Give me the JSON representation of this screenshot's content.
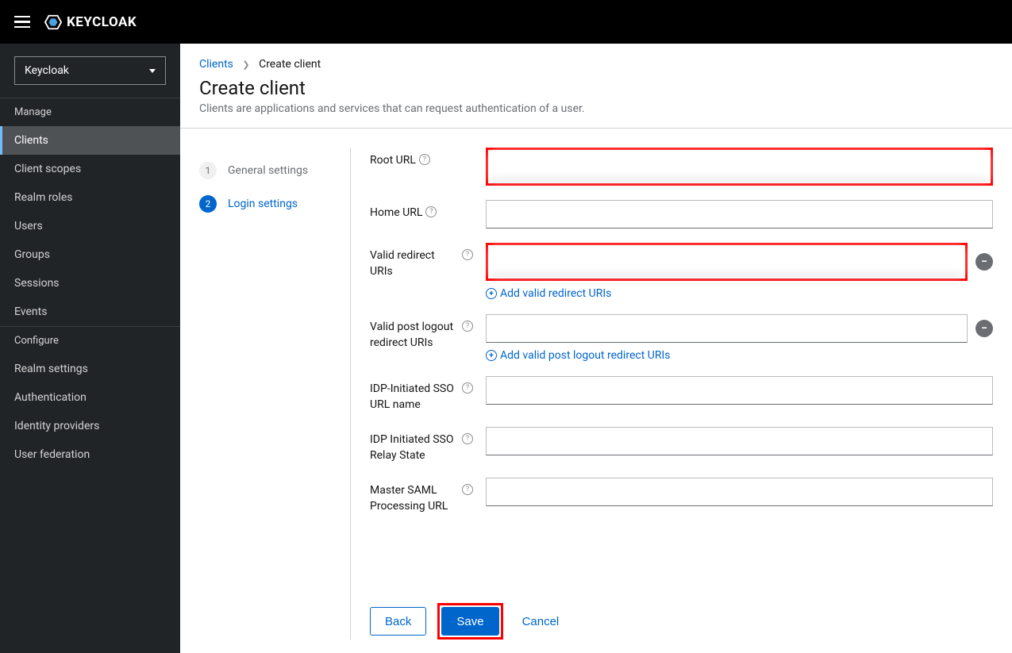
{
  "brand": "KEYCLOAK",
  "realmSelector": {
    "value": "Keycloak"
  },
  "sidebar": {
    "manageTitle": "Manage",
    "configureTitle": "Configure",
    "manage": [
      {
        "label": "Clients",
        "active": true
      },
      {
        "label": "Client scopes"
      },
      {
        "label": "Realm roles"
      },
      {
        "label": "Users"
      },
      {
        "label": "Groups"
      },
      {
        "label": "Sessions"
      },
      {
        "label": "Events"
      }
    ],
    "configure": [
      {
        "label": "Realm settings"
      },
      {
        "label": "Authentication"
      },
      {
        "label": "Identity providers"
      },
      {
        "label": "User federation"
      }
    ]
  },
  "breadcrumb": {
    "parent": "Clients",
    "current": "Create client"
  },
  "page": {
    "title": "Create client",
    "desc": "Clients are applications and services that can request authentication of a user."
  },
  "wizard": {
    "steps": [
      {
        "num": "1",
        "label": "General settings"
      },
      {
        "num": "2",
        "label": "Login settings",
        "active": true
      }
    ]
  },
  "form": {
    "rootUrl": {
      "label": "Root URL",
      "value": ""
    },
    "homeUrl": {
      "label": "Home URL",
      "value": ""
    },
    "validRedirect": {
      "label": "Valid redirect URIs",
      "value": "",
      "addLabel": "Add valid redirect URIs"
    },
    "validPostLogout": {
      "label": "Valid post logout redirect URIs",
      "value": "",
      "addLabel": "Add valid post logout redirect URIs"
    },
    "idpInitiatedSsoUrl": {
      "label": "IDP-Initiated SSO URL name",
      "value": ""
    },
    "idpInitiatedSsoRelay": {
      "label": "IDP Initiated SSO Relay State",
      "value": ""
    },
    "masterSaml": {
      "label": "Master SAML Processing URL",
      "value": ""
    }
  },
  "actions": {
    "back": "Back",
    "save": "Save",
    "cancel": "Cancel"
  }
}
